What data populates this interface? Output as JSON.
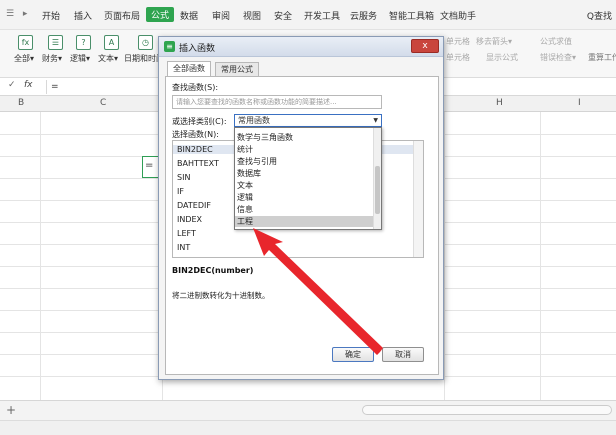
{
  "menubar": {
    "left_icons": "☰ ▸",
    "items": [
      "开始",
      "插入",
      "页面布局",
      "公式",
      "数据",
      "审阅",
      "视图",
      "安全",
      "开发工具",
      "云服务",
      "智能工具箱",
      "文档助手"
    ],
    "active_index": 3,
    "search": "Q查找"
  },
  "toolbar": {
    "groups": [
      {
        "icon": "fx",
        "label": "全部▾"
      },
      {
        "icon": "☰",
        "label": "财务▾"
      },
      {
        "icon": "?",
        "label": "逻辑▾"
      },
      {
        "icon": "A",
        "label": "文本▾"
      },
      {
        "icon": "◷",
        "label": "日期和时间"
      }
    ],
    "right_labels": [
      "单元格",
      "移去箭头▾",
      "公式求值",
      "单元格",
      "显示公式",
      "错误检查▾",
      "重算工作簿"
    ]
  },
  "formula_bar": {
    "check": "✓",
    "fx": "fx",
    "content": "="
  },
  "columns": [
    "B",
    "C",
    "H",
    "I"
  ],
  "active_cell_value": "=",
  "dialog": {
    "title": "插入函数",
    "close": "x",
    "tabs": [
      "全部函数",
      "常用公式"
    ],
    "search_label": "查找函数(S):",
    "search_placeholder": "请输入您要查找的函数名称或函数功能的简要描述...",
    "category_label": "或选择类别(C):",
    "category_value": "常用函数",
    "select_label": "选择函数(N):",
    "functions": [
      "BIN2DEC",
      "BAHTTEXT",
      "SIN",
      "IF",
      "DATEDIF",
      "INDEX",
      "LEFT",
      "INT"
    ],
    "selected_function": 0,
    "category_options": [
      "数学与三角函数",
      "统计",
      "查找与引用",
      "数据库",
      "文本",
      "逻辑",
      "信息",
      "工程"
    ],
    "highlighted_option": 7,
    "signature": "BIN2DEC(number)",
    "description": "将二进制数转化为十进制数。",
    "ok": "确定",
    "cancel": "取消"
  },
  "annotation": {
    "arrow_color": "#e8262c"
  }
}
